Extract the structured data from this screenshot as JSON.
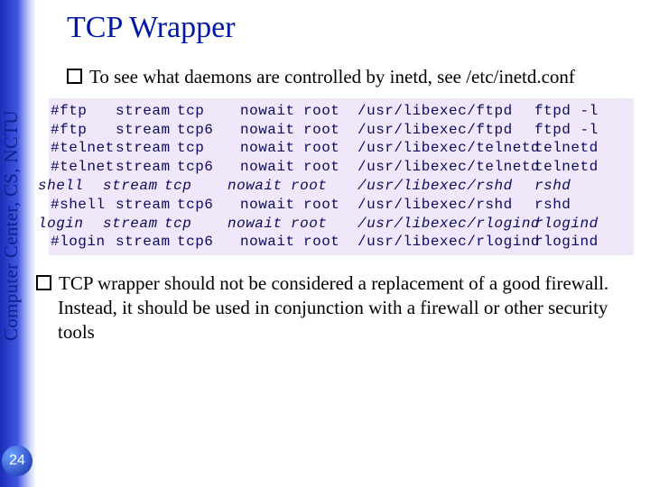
{
  "sidebar": {
    "vertical_text": "Computer Center, CS, NCTU"
  },
  "page_number": "24",
  "title": "TCP Wrapper",
  "bullet1": "To see what daemons are controlled by inetd, see /etc/inetd.conf",
  "bullet2": "TCP wrapper should not be considered a replacement of a good firewall. Instead, it should be used in conjunction with a firewall or other security tools",
  "code": {
    "rows": [
      {
        "c1": "#ftp",
        "c2": "stream",
        "c3": "tcp",
        "c4": "nowait",
        "c5": "root",
        "c6": "/usr/libexec/ftpd",
        "c7": "ftpd -l",
        "italic": false,
        "shift": false
      },
      {
        "c1": "#ftp",
        "c2": "stream",
        "c3": "tcp6",
        "c4": "nowait",
        "c5": "root",
        "c6": "/usr/libexec/ftpd",
        "c7": "ftpd -l",
        "italic": false,
        "shift": false
      },
      {
        "c1": "#telnet",
        "c2": "stream",
        "c3": "tcp",
        "c4": "nowait",
        "c5": "root",
        "c6": "/usr/libexec/telnetd",
        "c7": "telnetd",
        "italic": false,
        "shift": false
      },
      {
        "c1": "#telnet",
        "c2": "stream",
        "c3": "tcp6",
        "c4": "nowait",
        "c5": "root",
        "c6": "/usr/libexec/telnetd",
        "c7": "telnetd",
        "italic": false,
        "shift": false
      },
      {
        "c1": "shell",
        "c2": "stream",
        "c3": "tcp",
        "c4": "nowait",
        "c5": "root",
        "c6": "/usr/libexec/rshd",
        "c7": "rshd",
        "italic": true,
        "shift": true
      },
      {
        "c1": "#shell",
        "c2": "stream",
        "c3": "tcp6",
        "c4": "nowait",
        "c5": "root",
        "c6": "/usr/libexec/rshd",
        "c7": "rshd",
        "italic": false,
        "shift": false
      },
      {
        "c1": "login",
        "c2": "stream",
        "c3": "tcp",
        "c4": "nowait",
        "c5": "root",
        "c6": "/usr/libexec/rlogind",
        "c7": "rlogind",
        "italic": true,
        "shift": true
      },
      {
        "c1": "#login",
        "c2": "stream",
        "c3": "tcp6",
        "c4": "nowait",
        "c5": "root",
        "c6": "/usr/libexec/rlogind",
        "c7": "rlogind",
        "italic": false,
        "shift": false
      }
    ]
  }
}
